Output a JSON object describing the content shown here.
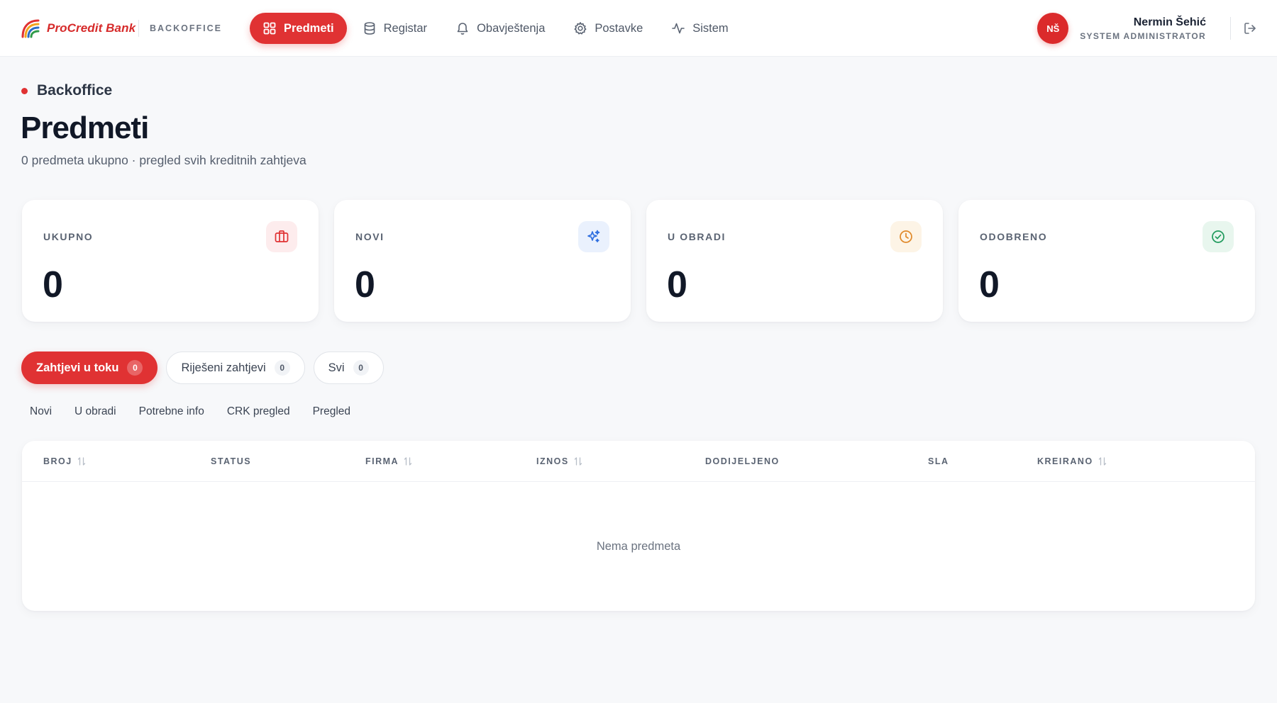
{
  "brand": {
    "name": "ProCredit Bank",
    "section": "BACKOFFICE"
  },
  "nav": {
    "items": [
      {
        "label": "Predmeti",
        "icon": "grid-icon",
        "active": true
      },
      {
        "label": "Registar",
        "icon": "database-icon",
        "active": false
      },
      {
        "label": "Obavještenja",
        "icon": "bell-icon",
        "active": false
      },
      {
        "label": "Postavke",
        "icon": "gear-icon",
        "active": false
      },
      {
        "label": "Sistem",
        "icon": "activity-icon",
        "active": false
      }
    ]
  },
  "user": {
    "initials": "NŠ",
    "name": "Nermin Šehić",
    "role": "SYSTEM ADMINISTRATOR"
  },
  "header": {
    "breadcrumb": "Backoffice",
    "title": "Predmeti",
    "subtitle": "0 predmeta ukupno · pregled svih kreditnih zahtjeva"
  },
  "stats": [
    {
      "label": "UKUPNO",
      "value": "0",
      "icon": "briefcase-icon",
      "color": "#e03233",
      "bg": "#fdeced"
    },
    {
      "label": "NOVI",
      "value": "0",
      "icon": "sparkles-icon",
      "color": "#2f6fe0",
      "bg": "#eaf1fd"
    },
    {
      "label": "U OBRADI",
      "value": "0",
      "icon": "clock-icon",
      "color": "#e0892a",
      "bg": "#fdf4e6"
    },
    {
      "label": "ODOBRENO",
      "value": "0",
      "icon": "check-circle-icon",
      "color": "#1f9a5c",
      "bg": "#e8f6ee"
    }
  ],
  "tabs": [
    {
      "label": "Zahtjevi u toku",
      "count": "0",
      "active": true
    },
    {
      "label": "Riješeni zahtjevi",
      "count": "0",
      "active": false
    },
    {
      "label": "Svi",
      "count": "0",
      "active": false
    }
  ],
  "filters": [
    "Novi",
    "U obradi",
    "Potrebne info",
    "CRK pregled",
    "Pregled"
  ],
  "table": {
    "columns": [
      {
        "label": "BROJ",
        "sortable": true
      },
      {
        "label": "STATUS",
        "sortable": false
      },
      {
        "label": "FIRMA",
        "sortable": true
      },
      {
        "label": "IZNOS",
        "sortable": true
      },
      {
        "label": "DODIJELJENO",
        "sortable": false
      },
      {
        "label": "SLA",
        "sortable": false
      },
      {
        "label": "KREIRANO",
        "sortable": true
      }
    ],
    "empty_text": "Nema predmeta"
  },
  "colors": {
    "accent": "#e03233",
    "background": "#f7f8fa"
  }
}
